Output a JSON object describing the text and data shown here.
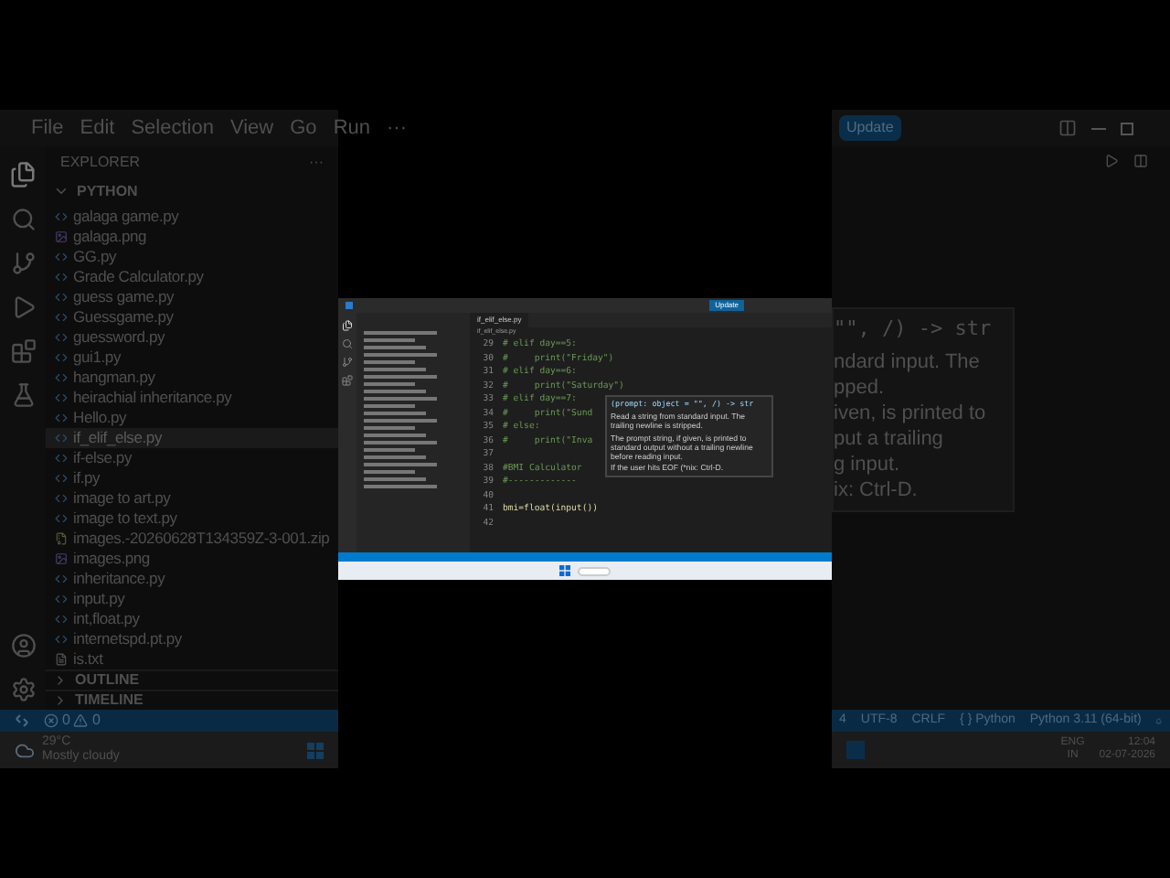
{
  "left_backdrop": {
    "menu": [
      "File",
      "Edit",
      "Selection",
      "View",
      "Go",
      "Run",
      "···"
    ],
    "explorer_title": "EXPLORER",
    "explorer_more": "···",
    "folder": "PYTHON",
    "files": [
      {
        "name": "galaga game.py",
        "kind": "py",
        "selected": false
      },
      {
        "name": "galaga.png",
        "kind": "image",
        "selected": false
      },
      {
        "name": "GG.py",
        "kind": "py",
        "selected": false
      },
      {
        "name": "Grade Calculator.py",
        "kind": "py",
        "selected": false
      },
      {
        "name": "guess game.py",
        "kind": "py",
        "selected": false
      },
      {
        "name": "Guessgame.py",
        "kind": "py",
        "selected": false
      },
      {
        "name": "guessword.py",
        "kind": "py",
        "selected": false
      },
      {
        "name": "gui1.py",
        "kind": "py",
        "selected": false
      },
      {
        "name": "hangman.py",
        "kind": "py",
        "selected": false
      },
      {
        "name": "heirachial inheritance.py",
        "kind": "py",
        "selected": false
      },
      {
        "name": "Hello.py",
        "kind": "py",
        "selected": false
      },
      {
        "name": "if_elif_else.py",
        "kind": "py",
        "selected": true
      },
      {
        "name": "if-else.py",
        "kind": "py",
        "selected": false
      },
      {
        "name": "if.py",
        "kind": "py",
        "selected": false
      },
      {
        "name": "image to art.py",
        "kind": "py",
        "selected": false
      },
      {
        "name": "image to text.py",
        "kind": "py",
        "selected": false
      },
      {
        "name": "images.-20260628T134359Z-3-001.zip",
        "kind": "zip",
        "selected": false
      },
      {
        "name": "images.png",
        "kind": "image",
        "selected": false
      },
      {
        "name": "inheritance.py",
        "kind": "py",
        "selected": false
      },
      {
        "name": "input.py",
        "kind": "py",
        "selected": false
      },
      {
        "name": "int,float.py",
        "kind": "py",
        "selected": false
      },
      {
        "name": "internetspd.pt.py",
        "kind": "py",
        "selected": false
      },
      {
        "name": "is.txt",
        "kind": "text",
        "selected": false
      }
    ],
    "sections": [
      "OUTLINE",
      "TIMELINE"
    ],
    "errors": "0",
    "warnings": "0",
    "weather": {
      "temp": "29°C",
      "desc": "Mostly cloudy"
    }
  },
  "inset": {
    "update": "Update",
    "tab": "if_elif_else.py",
    "breadcrumb": "if_elif_else.py",
    "code_lines": [
      {
        "num": "29",
        "text": "# elif day==5:"
      },
      {
        "num": "30",
        "text": "#     print(\"Friday\")"
      },
      {
        "num": "31",
        "text": "# elif day==6:"
      },
      {
        "num": "32",
        "text": "#     print(\"Saturday\")"
      },
      {
        "num": "33",
        "text": "# elif day==7:"
      },
      {
        "num": "34",
        "text": "#     print(\"Sund"
      },
      {
        "num": "35",
        "text": "# else:"
      },
      {
        "num": "36",
        "text": "#     print(\"Inva"
      },
      {
        "num": "37"
      },
      {
        "num": "38",
        "text": "#BMI Calculator"
      },
      {
        "num": "39",
        "text": "#-------------"
      },
      {
        "num": "40"
      },
      {
        "num": "41",
        "text": "bmi=float(input())"
      },
      {
        "num": "42"
      }
    ],
    "tooltip": {
      "signature": "(prompt: object = \"\", /) -> str",
      "paragraphs": [
        "Read a string from standard input. The trailing newline is stripped.",
        "The prompt string, if given, is printed to standard output without a trailing newline before reading input.",
        "If the user hits EOF (*nix: Ctrl-D."
      ]
    }
  },
  "right_backdrop": {
    "update": "Update",
    "tooltip_fragments": [
      "\"\", /) -> str",
      "ndard input. The",
      "pped.",
      "iven, is printed to",
      "put a trailing",
      "g input.",
      "ix: Ctrl-D."
    ],
    "status": [
      "4",
      "UTF-8",
      "CRLF",
      "{ } Python",
      "Python 3.11 (64-bit)"
    ],
    "tray": {
      "lang": "ENG",
      "region": "IN",
      "time": "12:04",
      "date": "02-07-2026"
    }
  }
}
